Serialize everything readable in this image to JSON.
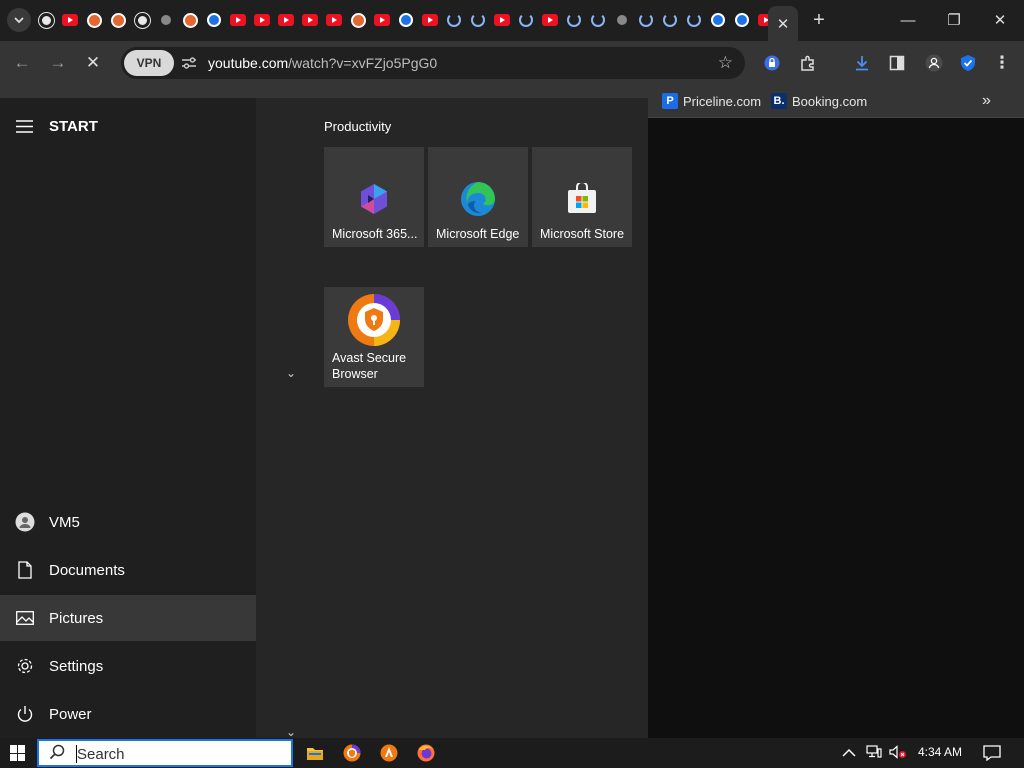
{
  "browser": {
    "tab_favicons": [
      "github",
      "youtube",
      "duckduckgo",
      "duckduckgo",
      "github",
      "generic",
      "duckduckgo",
      "blue",
      "youtube",
      "youtube",
      "youtube",
      "youtube",
      "youtube",
      "duckduckgo",
      "youtube",
      "blue",
      "youtube",
      "loading",
      "loading",
      "youtube",
      "loading",
      "youtube",
      "loading",
      "loading",
      "generic",
      "loading",
      "loading",
      "loading",
      "blue",
      "blue",
      "youtube"
    ],
    "active_tab_close": "✕",
    "new_tab": "+",
    "window_controls": {
      "minimize": "—",
      "restore": "❐",
      "close": "✕"
    },
    "toolbar": {
      "back": "←",
      "forward": "→",
      "stop": "✕",
      "vpn_label": "VPN",
      "url_host": "youtube.com",
      "url_path": "/watch?v=xvFZjo5PgG0",
      "star": "☆"
    },
    "bookmarks": [
      {
        "label": "Priceline.com",
        "icon_text": "P",
        "color": "#1a6ce8"
      },
      {
        "label": "Booking.com",
        "icon_text": "B.",
        "color": "#0a2f6b"
      }
    ],
    "bookmarks_overflow": "»"
  },
  "start_menu": {
    "title": "START",
    "nav": [
      {
        "label": "VM5",
        "icon": "user-icon"
      },
      {
        "label": "Documents",
        "icon": "document-icon"
      },
      {
        "label": "Pictures",
        "icon": "pictures-icon"
      },
      {
        "label": "Settings",
        "icon": "settings-icon"
      },
      {
        "label": "Power",
        "icon": "power-icon"
      }
    ],
    "group_title": "Productivity",
    "tiles": [
      {
        "label": "Microsoft 365...",
        "icon": "microsoft-365-icon"
      },
      {
        "label": "Microsoft Edge",
        "icon": "edge-icon"
      },
      {
        "label": "Microsoft Store",
        "icon": "store-icon"
      },
      {
        "label": "Avast Secure Browser",
        "icon": "avast-icon"
      }
    ],
    "collapse_chevron": "⌄",
    "scroll_chevron": "⌄"
  },
  "taskbar": {
    "search_placeholder": "Search",
    "apps": [
      "file-explorer-icon",
      "browser-icon",
      "avast-icon",
      "firefox-icon"
    ],
    "tray_chevron": "^",
    "clock": "4:34 AM"
  },
  "colors": {
    "accent": "#1a73e8",
    "youtube_red": "#ee1122",
    "tile_bg": "#3a3a3a",
    "start_bg": "#262626"
  }
}
